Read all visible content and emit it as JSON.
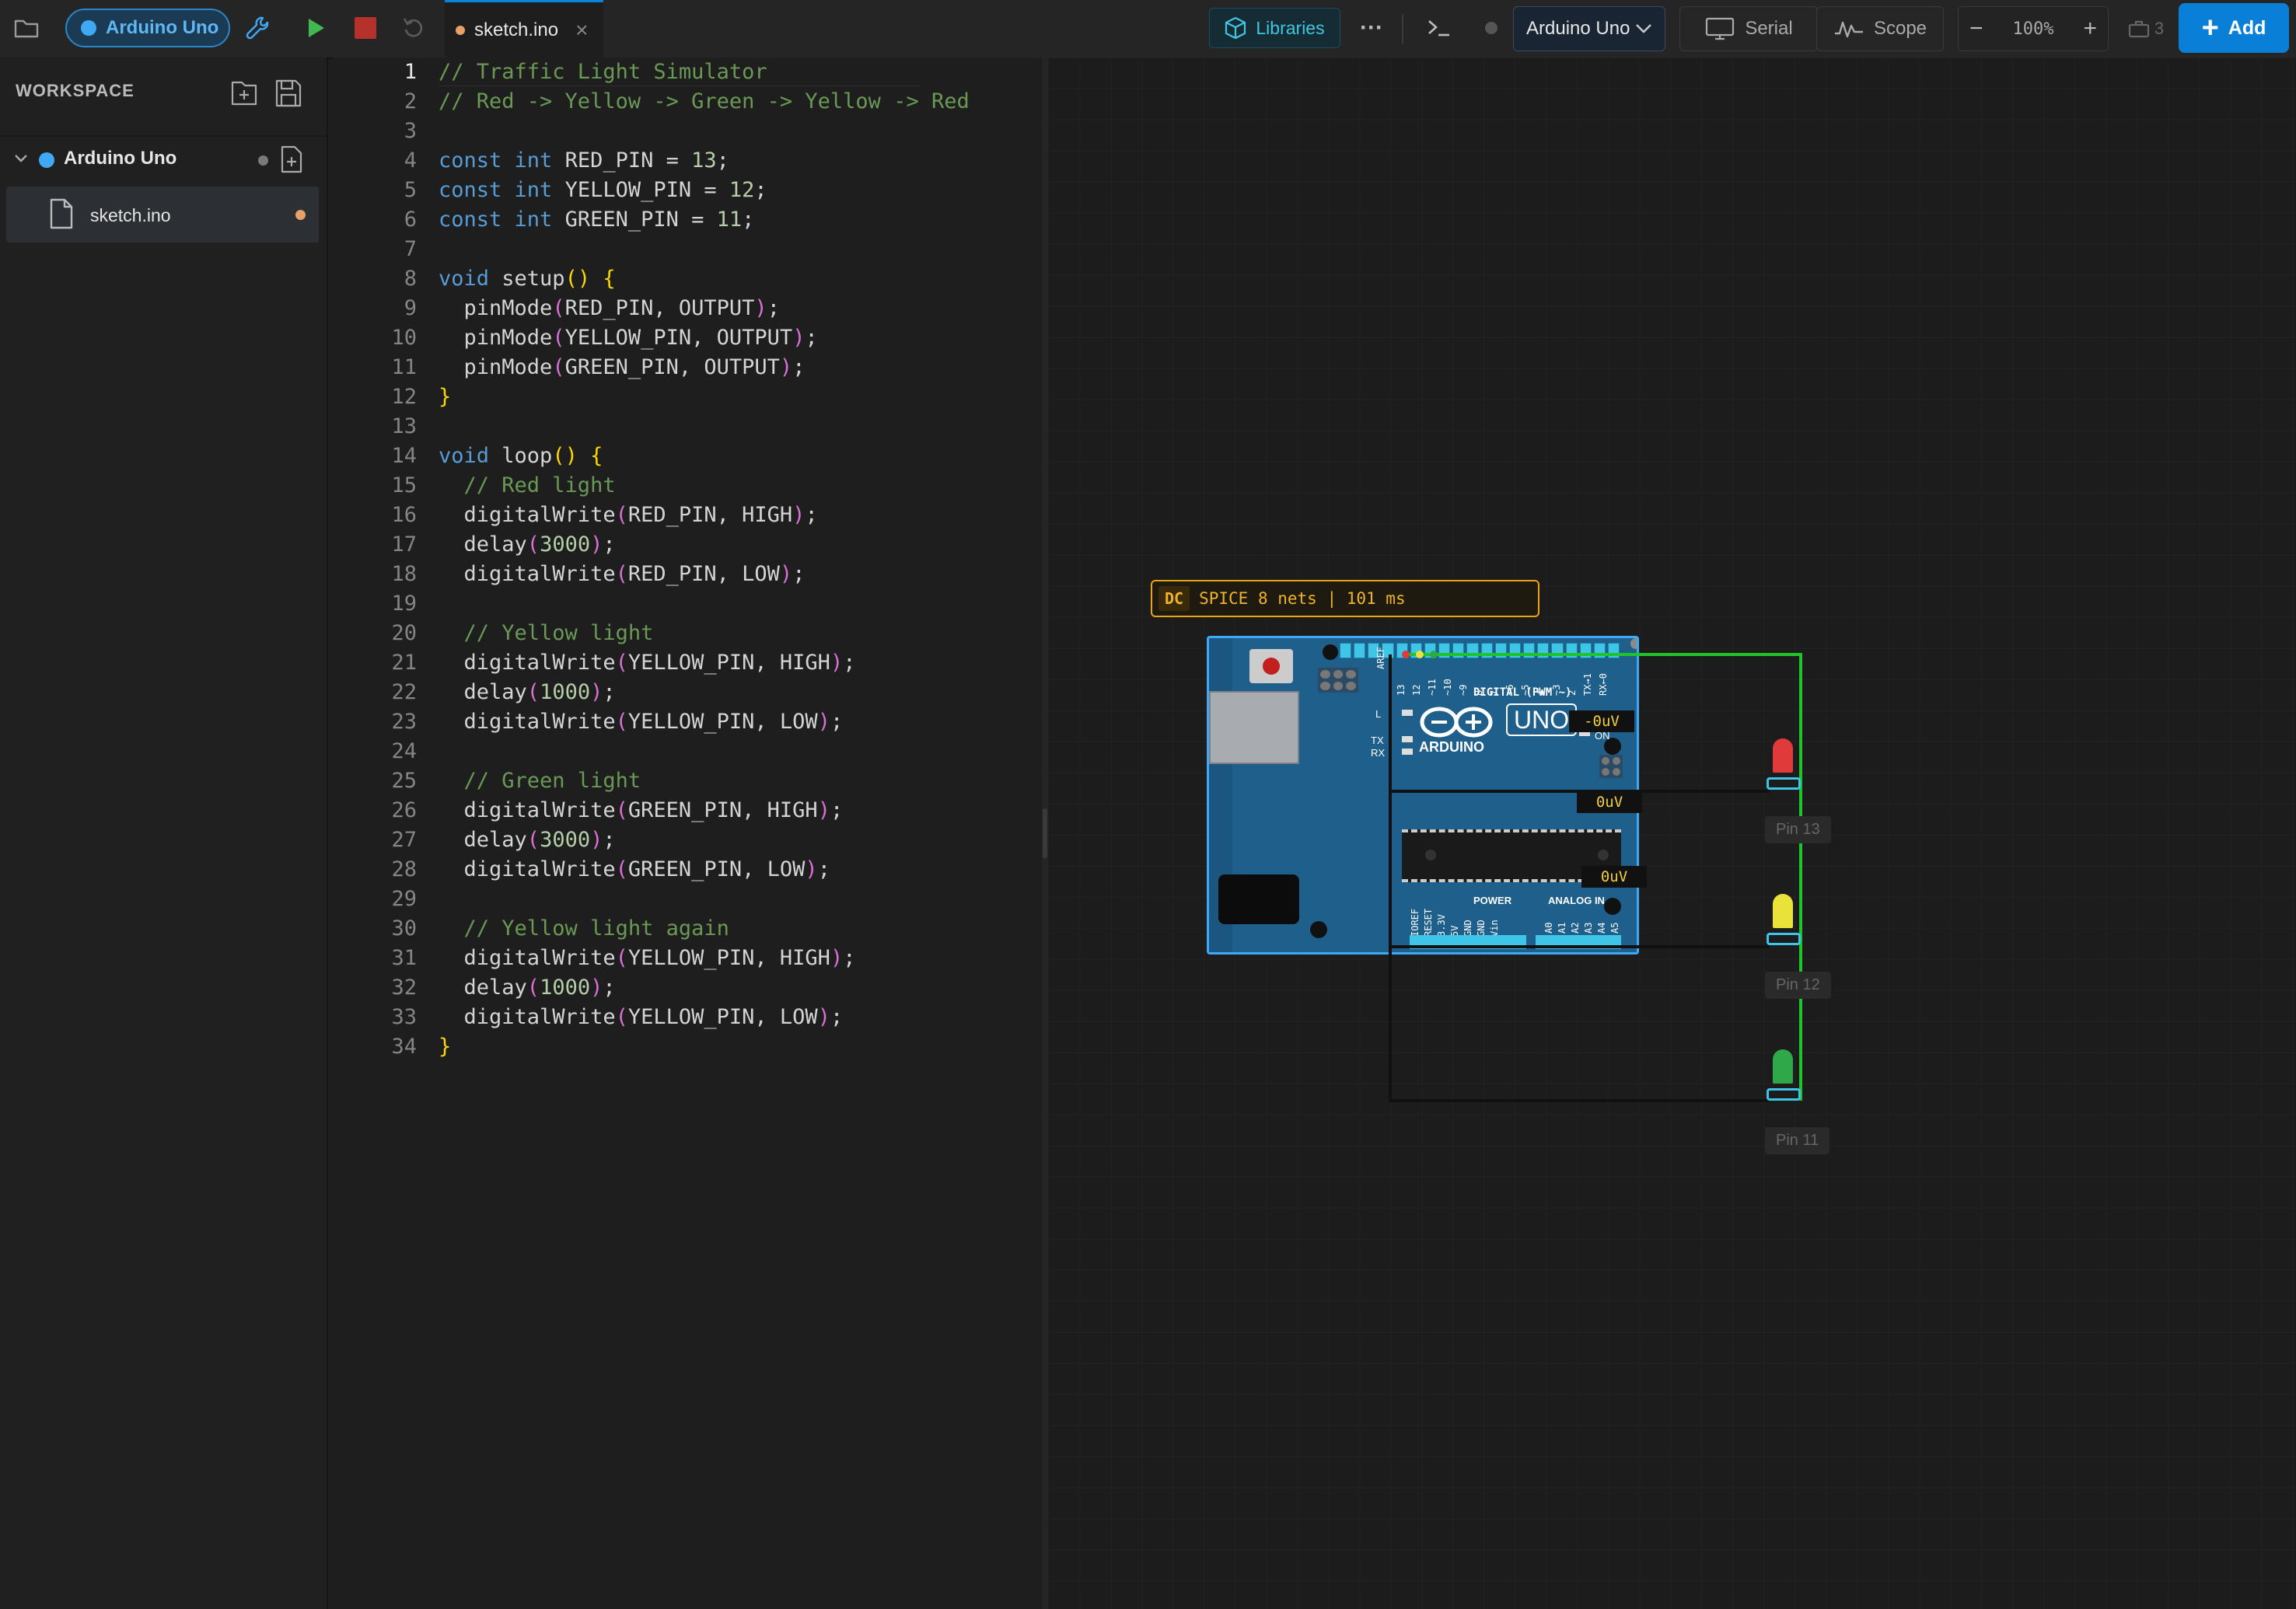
{
  "toolbar": {
    "board_chip": "Arduino Uno",
    "tab_label": "sketch.ino",
    "tab_close": "×",
    "libraries_label": "Libraries",
    "more_label": "···",
    "board_select": "Arduino Uno",
    "serial_label": "Serial",
    "scope_label": "Scope",
    "zoom_minus": "−",
    "zoom_level": "100%",
    "zoom_plus": "+",
    "component_count": "3",
    "add_label": "Add"
  },
  "sidebar": {
    "header": "WORKSPACE",
    "project_name": "Arduino Uno",
    "file_name": "sketch.ino"
  },
  "editor": {
    "lines": [
      [
        [
          "c",
          "// Traffic Light Simulator"
        ]
      ],
      [
        [
          "c",
          "// Red -> Yellow -> Green -> Yellow -> Red"
        ]
      ],
      [],
      [
        [
          "k",
          "const"
        ],
        [
          "t",
          " "
        ],
        [
          "k",
          "int"
        ],
        [
          "t",
          " RED_PIN = "
        ],
        [
          "n",
          "13"
        ],
        [
          "t",
          ";"
        ]
      ],
      [
        [
          "k",
          "const"
        ],
        [
          "t",
          " "
        ],
        [
          "k",
          "int"
        ],
        [
          "t",
          " YELLOW_PIN = "
        ],
        [
          "n",
          "12"
        ],
        [
          "t",
          ";"
        ]
      ],
      [
        [
          "k",
          "const"
        ],
        [
          "t",
          " "
        ],
        [
          "k",
          "int"
        ],
        [
          "t",
          " GREEN_PIN = "
        ],
        [
          "n",
          "11"
        ],
        [
          "t",
          ";"
        ]
      ],
      [],
      [
        [
          "k",
          "void"
        ],
        [
          "t",
          " setup"
        ],
        [
          "p",
          "()"
        ],
        [
          "t",
          " "
        ],
        [
          "p",
          "{"
        ]
      ],
      [
        [
          "t",
          "  pinMode"
        ],
        [
          "q",
          "("
        ],
        [
          "t",
          "RED_PIN, OUTPUT"
        ],
        [
          "q",
          ")"
        ],
        [
          "t",
          ";"
        ]
      ],
      [
        [
          "t",
          "  pinMode"
        ],
        [
          "q",
          "("
        ],
        [
          "t",
          "YELLOW_PIN, OUTPUT"
        ],
        [
          "q",
          ")"
        ],
        [
          "t",
          ";"
        ]
      ],
      [
        [
          "t",
          "  pinMode"
        ],
        [
          "q",
          "("
        ],
        [
          "t",
          "GREEN_PIN, OUTPUT"
        ],
        [
          "q",
          ")"
        ],
        [
          "t",
          ";"
        ]
      ],
      [
        [
          "p",
          "}"
        ]
      ],
      [],
      [
        [
          "k",
          "void"
        ],
        [
          "t",
          " loop"
        ],
        [
          "p",
          "()"
        ],
        [
          "t",
          " "
        ],
        [
          "p",
          "{"
        ]
      ],
      [
        [
          "c",
          "  // Red light"
        ]
      ],
      [
        [
          "t",
          "  digitalWrite"
        ],
        [
          "q",
          "("
        ],
        [
          "t",
          "RED_PIN, HIGH"
        ],
        [
          "q",
          ")"
        ],
        [
          "t",
          ";"
        ]
      ],
      [
        [
          "t",
          "  delay"
        ],
        [
          "q",
          "("
        ],
        [
          "n",
          "3000"
        ],
        [
          "q",
          ")"
        ],
        [
          "t",
          ";"
        ]
      ],
      [
        [
          "t",
          "  digitalWrite"
        ],
        [
          "q",
          "("
        ],
        [
          "t",
          "RED_PIN, LOW"
        ],
        [
          "q",
          ")"
        ],
        [
          "t",
          ";"
        ]
      ],
      [],
      [
        [
          "c",
          "  // Yellow light"
        ]
      ],
      [
        [
          "t",
          "  digitalWrite"
        ],
        [
          "q",
          "("
        ],
        [
          "t",
          "YELLOW_PIN, HIGH"
        ],
        [
          "q",
          ")"
        ],
        [
          "t",
          ";"
        ]
      ],
      [
        [
          "t",
          "  delay"
        ],
        [
          "q",
          "("
        ],
        [
          "n",
          "1000"
        ],
        [
          "q",
          ")"
        ],
        [
          "t",
          ";"
        ]
      ],
      [
        [
          "t",
          "  digitalWrite"
        ],
        [
          "q",
          "("
        ],
        [
          "t",
          "YELLOW_PIN, LOW"
        ],
        [
          "q",
          ")"
        ],
        [
          "t",
          ";"
        ]
      ],
      [],
      [
        [
          "c",
          "  // Green light"
        ]
      ],
      [
        [
          "t",
          "  digitalWrite"
        ],
        [
          "q",
          "("
        ],
        [
          "t",
          "GREEN_PIN, HIGH"
        ],
        [
          "q",
          ")"
        ],
        [
          "t",
          ";"
        ]
      ],
      [
        [
          "t",
          "  delay"
        ],
        [
          "q",
          "("
        ],
        [
          "n",
          "3000"
        ],
        [
          "q",
          ")"
        ],
        [
          "t",
          ";"
        ]
      ],
      [
        [
          "t",
          "  digitalWrite"
        ],
        [
          "q",
          "("
        ],
        [
          "t",
          "GREEN_PIN, LOW"
        ],
        [
          "q",
          ")"
        ],
        [
          "t",
          ";"
        ]
      ],
      [],
      [
        [
          "c",
          "  // Yellow light again"
        ]
      ],
      [
        [
          "t",
          "  digitalWrite"
        ],
        [
          "q",
          "("
        ],
        [
          "t",
          "YELLOW_PIN, HIGH"
        ],
        [
          "q",
          ")"
        ],
        [
          "t",
          ";"
        ]
      ],
      [
        [
          "t",
          "  delay"
        ],
        [
          "q",
          "("
        ],
        [
          "n",
          "1000"
        ],
        [
          "q",
          ")"
        ],
        [
          "t",
          ";"
        ]
      ],
      [
        [
          "t",
          "  digitalWrite"
        ],
        [
          "q",
          "("
        ],
        [
          "t",
          "YELLOW_PIN, LOW"
        ],
        [
          "q",
          ")"
        ],
        [
          "t",
          ";"
        ]
      ],
      [
        [
          "p",
          "}"
        ]
      ]
    ]
  },
  "canvas": {
    "spice_badge": "DC",
    "spice_status": "SPICE 8 nets | 101 ms",
    "board": {
      "aref": "AREF",
      "digital_label": "DIGITAL (PWM ~)",
      "brand": "ARDUINO",
      "model": "UNO",
      "on_label": "ON",
      "l_label": "L",
      "tx_label": "TX",
      "rx_label": "RX",
      "power_label": "POWER",
      "analog_label": "ANALOG IN",
      "digital_pins": [
        "13",
        "12",
        "~11",
        "~10",
        "~9",
        "8",
        "7",
        "~6",
        "~5",
        "4",
        "~3",
        "2",
        "TX→1",
        "RX←0"
      ],
      "power_pins": [
        "IOREF",
        "RESET",
        "3.3V",
        "5V",
        "GND",
        "GND",
        "Vin"
      ],
      "analog_pins": [
        "A0",
        "A1",
        "A2",
        "A3",
        "A4",
        "A5"
      ]
    },
    "voltage_probes": [
      "-0uV",
      "0uV",
      "0uV"
    ],
    "leds": [
      {
        "label": "Pin 13",
        "color": "#e03a3a"
      },
      {
        "label": "Pin 12",
        "color": "#e8e23a"
      },
      {
        "label": "Pin 11",
        "color": "#2fa84a"
      }
    ]
  },
  "colors": {
    "accent": "#0a84d8",
    "run": "#3fb950",
    "stop": "#b5312b",
    "spice_border": "#e8a317",
    "wire_green": "#1fc42a",
    "board_blue": "#1f5f8c"
  }
}
